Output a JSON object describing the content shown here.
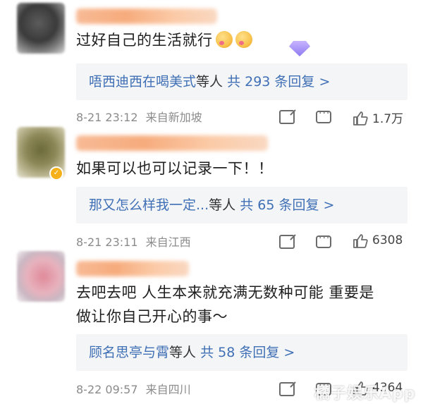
{
  "comments": [
    {
      "text": "过好自己的生活就行",
      "emojis": [
        "face-with-hearts-emoji",
        "face-with-hearts-emoji"
      ],
      "reply_users": "唔西迪西在喝美式",
      "reply_mid": "等人",
      "reply_count": "共 293 条回复 >",
      "time": "8-21 23:12",
      "location": "来自新加坡",
      "likes": "1.7万"
    },
    {
      "text": "如果可以也可以记录一下！！",
      "reply_users": "那又怎么样我一定...",
      "reply_mid": "等人",
      "reply_count": "共 65 条回复 >",
      "time": "8-21 23:11",
      "location": "来自江西",
      "likes": "6308"
    },
    {
      "text_line1": "去吧去吧 人生本来就充满无数种可能 重要是",
      "text_line2": "做让你自己开心的事～",
      "reply_users": "顾名思亭与霄",
      "reply_mid": "等人",
      "reply_count": "共 58 条回复 >",
      "time": "8-22 09:57",
      "location": "来自四川",
      "likes": "4364"
    }
  ],
  "watermark": "橘子娱乐App",
  "colors": {
    "link": "#3f6fb5",
    "meta": "#8b8b8b",
    "reply_bg": "#f4f5f7"
  }
}
